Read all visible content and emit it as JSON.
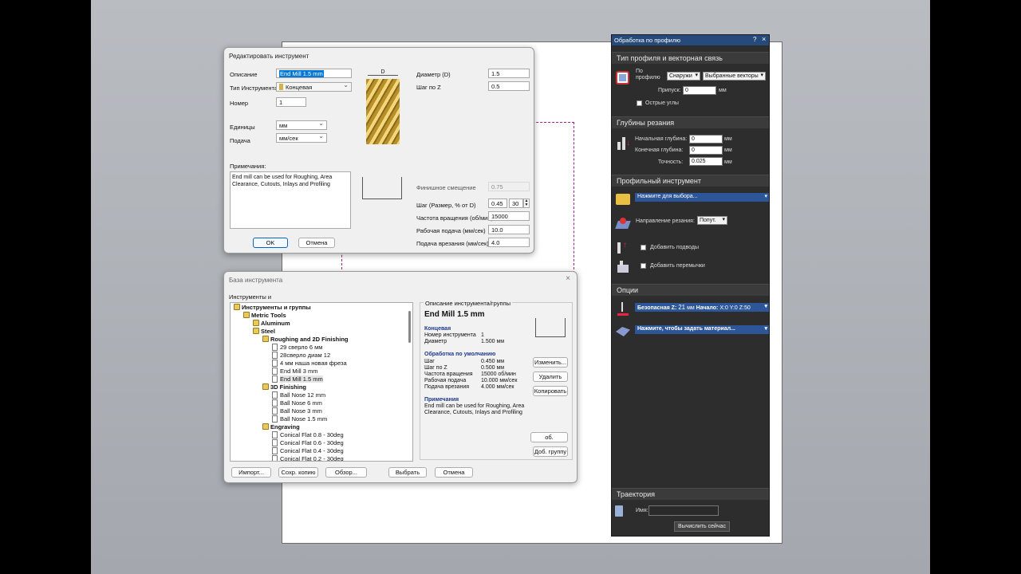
{
  "edit_tool": {
    "title": "Редактировать инструмент",
    "description_label": "Описание",
    "description_value": "End Mill 1.5 mm",
    "tool_type_label": "Тип Инструмента",
    "tool_type_value": "Концевая",
    "number_label": "Номер",
    "number_value": "1",
    "units_label": "Единицы",
    "units_value": "мм",
    "feed_label": "Подача",
    "feed_value": "мм/сек",
    "notes_label": "Примечания:",
    "notes_value": "End mill can be used for Roughing, Area Clearance, Cutouts, Inlays and Profiling",
    "diameter_label": "Диаметр (D)",
    "diameter_value": "1.5",
    "stepdown_label": "Шаг по Z",
    "stepdown_value": "0.5",
    "image_dim_label": "D",
    "finish_offset_label": "Финишное смещение",
    "finish_offset_value": "0.75",
    "stepover_label": "Шаг (Размер, % от D)",
    "stepover_value": "0.45",
    "stepover_percent": "30",
    "spindle_label": "Частота вращения (об/мин)",
    "spindle_value": "15000",
    "feedrate_label": "Рабочая подача (мм/сек)",
    "feedrate_value": "10.0",
    "plunge_label": "Подача врезания (мм/сек)",
    "plunge_value": "4.0",
    "ok_label": "OK",
    "cancel_label": "Отмена"
  },
  "tool_db": {
    "title": "База инструмента",
    "tools_groups_label": "Инструменты и",
    "tree": [
      {
        "label": "Инструменты и группы",
        "bold": true,
        "depth": 0
      },
      {
        "label": "Metric Tools",
        "bold": true,
        "depth": 1
      },
      {
        "label": "Aluminum",
        "bold": true,
        "depth": 2
      },
      {
        "label": "Steel",
        "bold": true,
        "depth": 2
      },
      {
        "label": "Roughing and 2D Finishing",
        "bold": true,
        "depth": 3
      },
      {
        "label": "29 сверло 6 мм",
        "bold": false,
        "depth": 4
      },
      {
        "label": "28сверло диам 12",
        "bold": false,
        "depth": 4
      },
      {
        "label": "4 мм наша новая фреза",
        "bold": false,
        "depth": 4
      },
      {
        "label": "End Mill 3 mm",
        "bold": false,
        "depth": 4
      },
      {
        "label": "End Mill 1.5 mm",
        "bold": false,
        "depth": 4
      },
      {
        "label": "3D Finishing",
        "bold": true,
        "depth": 3
      },
      {
        "label": "Ball Nose 12 mm",
        "bold": false,
        "depth": 4
      },
      {
        "label": "Ball Nose 6 mm",
        "bold": false,
        "depth": 4
      },
      {
        "label": "Ball Nose 3 mm",
        "bold": false,
        "depth": 4
      },
      {
        "label": "Ball Nose 1.5 mm",
        "bold": false,
        "depth": 4
      },
      {
        "label": "Engraving",
        "bold": true,
        "depth": 3
      },
      {
        "label": "Conical Flat 0.8 - 30deg",
        "bold": false,
        "depth": 4
      },
      {
        "label": "Conical Flat 0.6 - 30deg",
        "bold": false,
        "depth": 4
      },
      {
        "label": "Conical Flat 0.4 - 30deg",
        "bold": false,
        "depth": 4
      },
      {
        "label": "Conical Flat 0.2 - 30deg",
        "bold": false,
        "depth": 4
      }
    ],
    "desc_group_label": "Описание инструмента/группы",
    "tool_name": "End Mill 1.5 mm",
    "type_heading": "Концевая",
    "number_key": "Номер инструмента",
    "number_val": "1",
    "diameter_key": "Диаметр",
    "diameter_val": "1.500 мм",
    "defaults_heading": "Обработка по умолчанию",
    "props": [
      {
        "k": "Шаг",
        "v": "0.450 мм"
      },
      {
        "k": "Шаг по Z",
        "v": "0.500 мм"
      },
      {
        "k": "Частота вращения",
        "v": "15000 об/мин"
      },
      {
        "k": "Рабочая подача",
        "v": "10.000 мм/сек"
      },
      {
        "k": "Подача врезания",
        "v": "4.000 мм/сек"
      }
    ],
    "notes_heading": "Примечания",
    "notes_text": "End mill can be used for Roughing, Area Clearance, Cutouts, Inlays and Profiling",
    "edit_btn": "Изменить...",
    "delete_btn": "Удалить",
    "copy_btn": "Копировать",
    "add_tool_btn": "об. инструмен",
    "add_group_btn": "Доб. группу",
    "import_btn": "Импорт...",
    "save_copy_btn": "Сохр. копию",
    "browse_btn": "Обзор...",
    "select_btn": "Выбрать",
    "cancel_btn": "Отмена"
  },
  "panel": {
    "title": "Обработка по профилю",
    "help": "?",
    "close": "×",
    "sec_profile": "Тип профиля и векторная связь",
    "profile_label": "По профилю",
    "outside_value": "Снаружи",
    "vectors_value": "Выбранные векторы",
    "allowance_label": "Припуск:",
    "allowance_value": "0",
    "allowance_unit": "мм",
    "sharp_corners": "Острые углы",
    "sec_depths": "Глубины резания",
    "start_depth_label": "Начальная глубина:",
    "start_depth_value": "0",
    "end_depth_label": "Конечная глубина:",
    "end_depth_value": "0",
    "tolerance_label": "Точность:",
    "tolerance_value": "0.025",
    "unit_mm": "мм",
    "sec_tool": "Профильный инструмент",
    "select_tool": "Нажмите для выбора...",
    "direction_label": "Направление резания:",
    "direction_value": "Попут.",
    "add_ramps": "Добавить подводы",
    "add_tabs": "Добавить перемычки",
    "sec_options": "Опции",
    "safe_z": "Безопасная Z:",
    "safe_z_value": "21",
    "safe_z_unit": "мм",
    "home_label": "Начало:",
    "home_value": "X:0 Y:0 Z:50",
    "material_setup": "Нажмите, чтобы задать материал...",
    "sec_toolpath": "Траектория",
    "name_label": "Имя:",
    "name_value": "",
    "calculate_btn": "Вычислить сейчас"
  }
}
